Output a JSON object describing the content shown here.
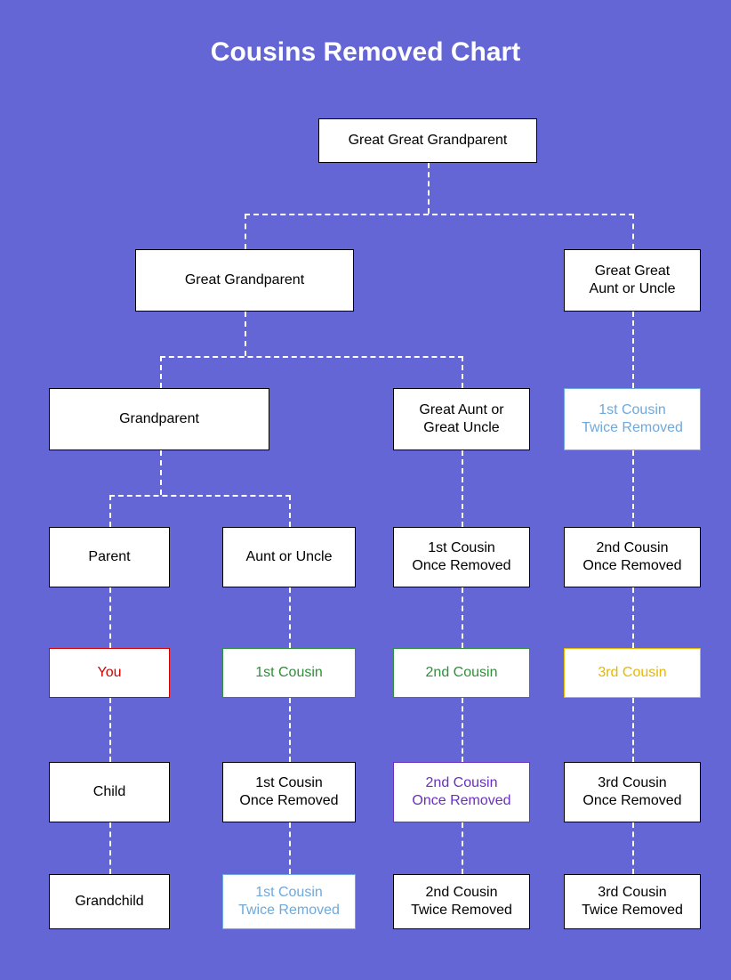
{
  "title": "Cousins Removed Chart",
  "nodes": {
    "ggg": "Great Great Grandparent",
    "ggp": "Great Grandparent",
    "gg_aunt": "Great Great\nAunt or Uncle",
    "grandp": "Grandparent",
    "g_aunt": "Great Aunt or\nGreat Uncle",
    "c1_tr_top": "1st Cousin\nTwice Removed",
    "parent": "Parent",
    "aunt": "Aunt or Uncle",
    "c1_or_top": "1st Cousin\nOnce Removed",
    "c2_or_top": "2nd Cousin\nOnce Removed",
    "you": "You",
    "c1": "1st Cousin",
    "c2": "2nd Cousin",
    "c3": "3rd Cousin",
    "child": "Child",
    "c1_or_bot": "1st Cousin\nOnce Removed",
    "c2_or_bot": "2nd Cousin\nOnce Removed",
    "c3_or_bot": "3rd Cousin\nOnce Removed",
    "grandchild": "Grandchild",
    "c1_tr_bot": "1st Cousin\nTwice Removed",
    "c2_tr_bot": "2nd Cousin\nTwice Removed",
    "c3_tr_bot": "3rd Cousin\nTwice Removed"
  },
  "chart_data": {
    "type": "tree",
    "title": "Cousins Removed Chart",
    "root": "Great Great Grandparent",
    "edges": [
      [
        "Great Great Grandparent",
        "Great Grandparent"
      ],
      [
        "Great Great Grandparent",
        "Great Great Aunt or Uncle"
      ],
      [
        "Great Grandparent",
        "Grandparent"
      ],
      [
        "Great Grandparent",
        "Great Aunt or Great Uncle"
      ],
      [
        "Great Great Aunt or Uncle",
        "1st Cousin Twice Removed (upper)"
      ],
      [
        "Grandparent",
        "Parent"
      ],
      [
        "Grandparent",
        "Aunt or Uncle"
      ],
      [
        "Great Aunt or Great Uncle",
        "1st Cousin Once Removed (upper)"
      ],
      [
        "1st Cousin Twice Removed (upper)",
        "2nd Cousin Once Removed (upper)"
      ],
      [
        "Parent",
        "You"
      ],
      [
        "Aunt or Uncle",
        "1st Cousin"
      ],
      [
        "1st Cousin Once Removed (upper)",
        "2nd Cousin"
      ],
      [
        "2nd Cousin Once Removed (upper)",
        "3rd Cousin"
      ],
      [
        "You",
        "Child"
      ],
      [
        "1st Cousin",
        "1st Cousin Once Removed (lower)"
      ],
      [
        "2nd Cousin",
        "2nd Cousin Once Removed (lower)"
      ],
      [
        "3rd Cousin",
        "3rd Cousin Once Removed (lower)"
      ],
      [
        "Child",
        "Grandchild"
      ],
      [
        "1st Cousin Once Removed (lower)",
        "1st Cousin Twice Removed (lower)"
      ],
      [
        "2nd Cousin Once Removed (lower)",
        "2nd Cousin Twice Removed (lower)"
      ],
      [
        "3rd Cousin Once Removed (lower)",
        "3rd Cousin Twice Removed (lower)"
      ]
    ],
    "highlights": {
      "red": [
        "You"
      ],
      "green": [
        "1st Cousin",
        "2nd Cousin"
      ],
      "yellow": [
        "3rd Cousin"
      ],
      "purple": [
        "2nd Cousin Once Removed (lower)"
      ],
      "blue": [
        "1st Cousin Twice Removed (upper)",
        "1st Cousin Twice Removed (lower)"
      ]
    }
  }
}
